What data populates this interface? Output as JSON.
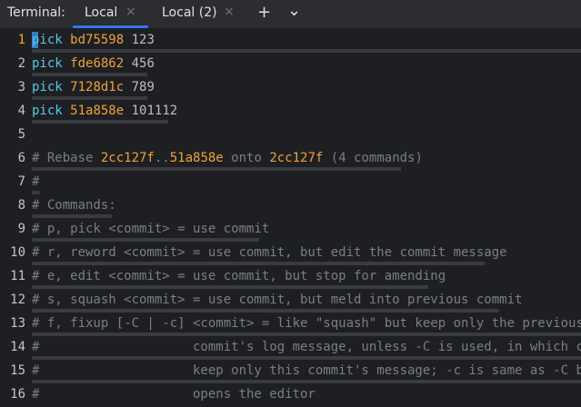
{
  "tabbar": {
    "label": "Terminal:",
    "tabs": [
      {
        "label": "Local",
        "close": "×",
        "active": true
      },
      {
        "label": "Local (2)",
        "close": "×",
        "active": false
      }
    ],
    "add_icon": "+",
    "dropdown_icon": "⌄"
  },
  "editor": {
    "lines": [
      {
        "n": "1",
        "cmd": "pick",
        "hash": "bd75598",
        "msg": "123"
      },
      {
        "n": "2",
        "cmd": "pick",
        "hash": "fde6862",
        "msg": "456"
      },
      {
        "n": "3",
        "cmd": "pick",
        "hash": "7128d1c",
        "msg": "789"
      },
      {
        "n": "4",
        "cmd": "pick",
        "hash": "51a858e",
        "msg": "101112"
      },
      {
        "n": "5"
      },
      {
        "n": "6",
        "pre": "# Rebase ",
        "h1": "2cc127f",
        "dots": "..",
        "h2": "51a858e",
        "mid": " onto ",
        "h3": "2cc127f",
        "post": " (4 commands)"
      },
      {
        "n": "7",
        "text": "#"
      },
      {
        "n": "8",
        "text": "# Commands:"
      },
      {
        "n": "9",
        "text": "# p, pick <commit> = use commit"
      },
      {
        "n": "10",
        "text": "# r, reword <commit> = use commit, but edit the commit message"
      },
      {
        "n": "11",
        "text": "# e, edit <commit> = use commit, but stop for amending"
      },
      {
        "n": "12",
        "text": "# s, squash <commit> = use commit, but meld into previous commit"
      },
      {
        "n": "13",
        "text": "# f, fixup [-C | -c] <commit> = like \"squash\" but keep only the previous"
      },
      {
        "n": "14",
        "text": "#                    commit's log message, unless -C is used, in which case"
      },
      {
        "n": "15",
        "text": "#                    keep only this commit's message; -c is same as -C but"
      },
      {
        "n": "16",
        "text": "#                    opens the editor"
      }
    ]
  }
}
